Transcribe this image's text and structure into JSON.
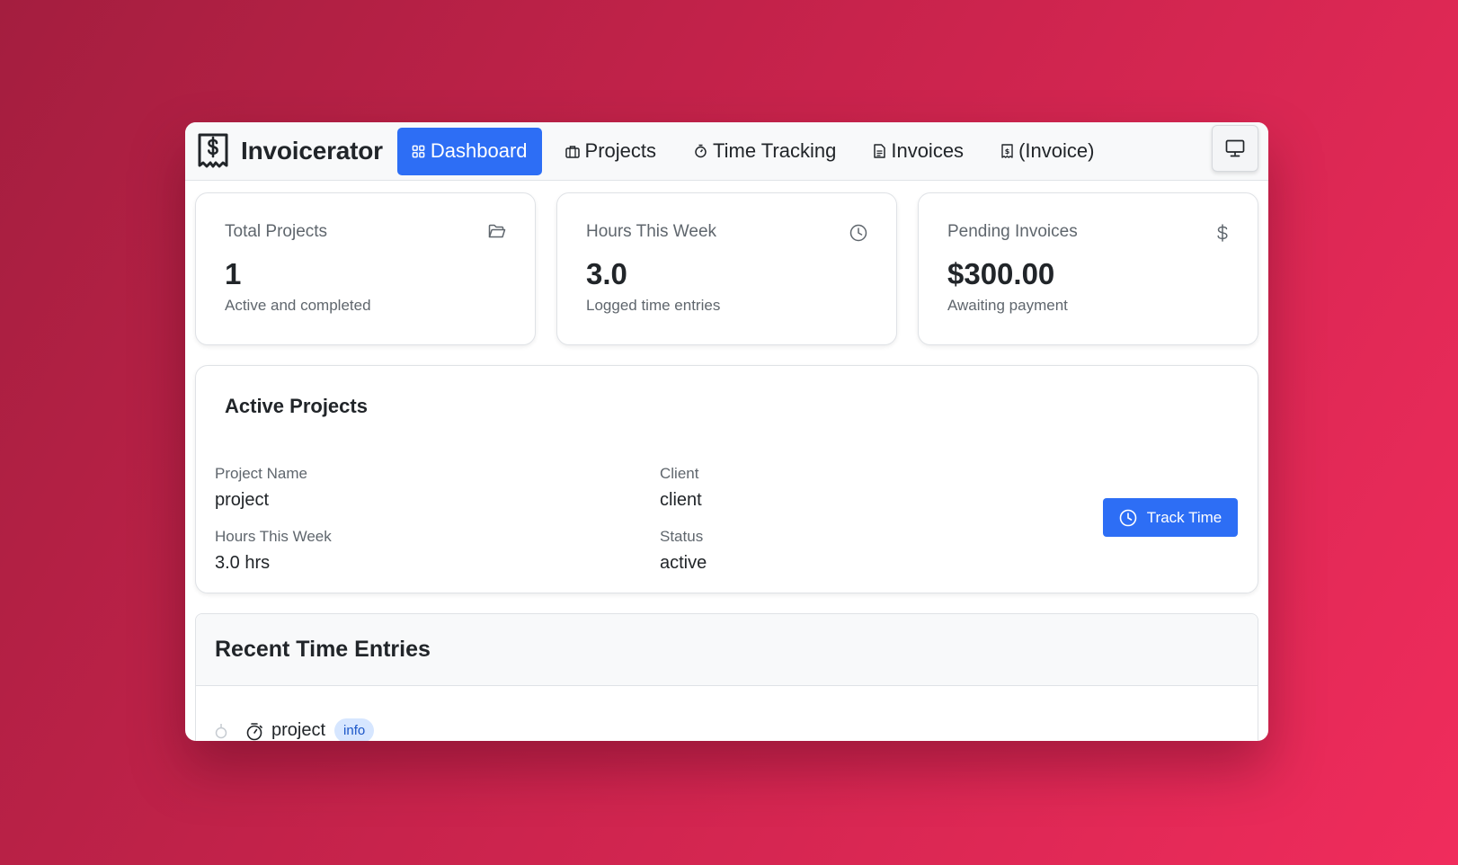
{
  "app": {
    "name": "Invoicerator"
  },
  "nav": {
    "items": [
      {
        "label": "Dashboard",
        "icon": "grid-icon",
        "active": true
      },
      {
        "label": "Projects",
        "icon": "briefcase-icon",
        "active": false
      },
      {
        "label": "Time Tracking",
        "icon": "stopwatch-icon",
        "active": false
      },
      {
        "label": "Invoices",
        "icon": "document-icon",
        "active": false
      },
      {
        "label": "(Invoice)",
        "icon": "invoice-dollar-icon",
        "active": false
      }
    ],
    "display_button_icon": "monitor-icon"
  },
  "stats": [
    {
      "title": "Total Projects",
      "value": "1",
      "subtitle": "Active and completed",
      "icon": "folder-open-icon"
    },
    {
      "title": "Hours This Week",
      "value": "3.0",
      "subtitle": "Logged time entries",
      "icon": "clock-icon"
    },
    {
      "title": "Pending Invoices",
      "value": "$300.00",
      "subtitle": "Awaiting payment",
      "icon": "dollar-icon"
    }
  ],
  "active_projects": {
    "title": "Active Projects",
    "project": {
      "name_label": "Project Name",
      "name": "project",
      "client_label": "Client",
      "client": "client",
      "hours_label": "Hours This Week",
      "hours": "3.0 hrs",
      "status_label": "Status",
      "status": "active"
    },
    "track_button": "Track Time"
  },
  "recent_entries": {
    "title": "Recent Time Entries",
    "entries": [
      {
        "project": "project",
        "badge": "info"
      }
    ]
  },
  "colors": {
    "accent": "#2d6ef5",
    "badge_bg": "#d6e6ff",
    "background_start": "#a41e3f",
    "background_end": "#f02c5c"
  }
}
